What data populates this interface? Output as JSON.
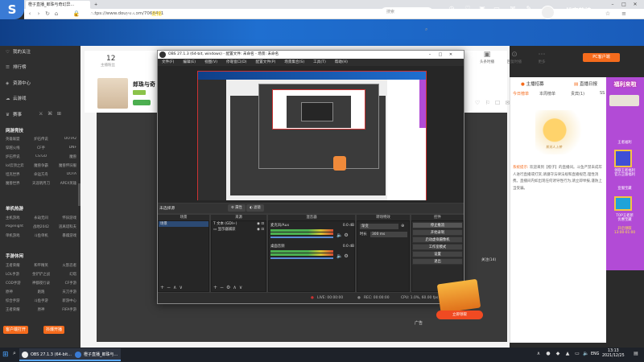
{
  "browser": {
    "tabs": [
      {
        "label": "橙子直播_郎珠与奇幻异..."
      },
      {
        "label": "+"
      }
    ],
    "url": "https://www.douyu.com/7068491"
  },
  "site": {
    "logo": "斗鱼",
    "nav": [
      "首页",
      "直播",
      "分类▾",
      "视频▾",
      "游戏▾",
      "鱼吧",
      "KPL秋决"
    ],
    "active_nav": "直播",
    "search_placeholder": "搜索",
    "right_icons": [
      {
        "label": "历史",
        "icon": "history-icon"
      },
      {
        "label": "关注",
        "icon": "follow-icon"
      },
      {
        "label": "开播",
        "icon": "broadcast-icon"
      },
      {
        "label": "客户端",
        "icon": "client-icon"
      },
      {
        "label": "消息",
        "icon": "message-icon"
      },
      {
        "label": "创作中心",
        "icon": "creator-icon"
      }
    ],
    "banner_text": "一战定乾坤"
  },
  "sidebar": {
    "items": [
      {
        "icon": "heart-icon",
        "label": "我的关注"
      },
      {
        "icon": "list-icon",
        "label": "排行榜"
      },
      {
        "icon": "resource-icon",
        "label": "资源中心"
      },
      {
        "icon": "cloud-icon",
        "label": "云游戏"
      },
      {
        "icon": "trophy-icon",
        "label": "赛事"
      }
    ],
    "sections": [
      {
        "title": "网游竞技",
        "items": [
          "英雄联盟",
          "炉石传说",
          "DOTA2",
          "穿越火线",
          "CF手",
          "DNF",
          "炉石传说",
          "CS:GO",
          "魔兽",
          "lol云顶之弈",
          "魔兽争霸",
          "魔兽怀旧服",
          "坦克世界",
          "命运方舟",
          "DOTA",
          "魔兽世界",
          "天涯明月刀",
          "APEX英雄"
        ]
      },
      {
        "title": "单机热游",
        "items": [
          "主机游戏",
          "永劫无间",
          "怀旧游戏",
          "Pogenight",
          "战地2042",
          "逃离塔科夫",
          "单机游戏",
          "斗鱼单机",
          "暴躁游戏"
        ]
      },
      {
        "title": "手游休闲",
        "items": [
          "王者荣耀",
          "和平精英",
          "火影忍者",
          "LOL手游",
          "金铲铲之战",
          "幻塔",
          "COD手游",
          "神都夜行录",
          "CF手游",
          "原神",
          "跑跑",
          "天刀手游",
          "综合手游",
          "斗鱼手游",
          "新游中心",
          "王者荣耀",
          "原神",
          "FIFA手游"
        ]
      }
    ],
    "buttons": [
      "客户端打开",
      "抖爆开播"
    ]
  },
  "room": {
    "stat_num": "12",
    "stat_label": "主播粉丝",
    "title": "郎珠与奇",
    "tools": [
      {
        "label": "头条时播",
        "icon": "camera-icon"
      },
      {
        "label": "回复时播",
        "icon": "reply-icon"
      },
      {
        "label": "更多",
        "icon": "more-icon"
      }
    ],
    "pc_client": "PC客户端",
    "time_badge": "关注(14)",
    "ad_label": "广告",
    "promo_btn": "立即领取"
  },
  "chat": {
    "top_left": "主播招募",
    "top_right": "直播日报",
    "tabs": [
      "今日榜单",
      "本周榜单",
      "贵宾(1)",
      "SS"
    ],
    "illus_text": "暂无人上榜",
    "system_msg_label": "系统提示:",
    "system_msg": "欢迎来到【橙子】的直播间。斗鱼严禁未成年人进行直播或打赏,请遵守法律法规和直播规范,理性消费。直播间内如出现任何诱导性行为,请立即举报,谨防上当受骗。"
  },
  "ads": {
    "top": "福利来啦",
    "items": [
      "王者福利",
      "领取王者福利\n官方正版福利",
      "亚服宝藏",
      "TOP王者新\n优惠宝藏",
      "开启领取\n13:00-01:00"
    ]
  },
  "obs": {
    "title": "OBS 27.1.3 (64-bit, windows) - 配置文件: 未命名 - 场景: 未命名",
    "menu": [
      "文件(F)",
      "编辑(E)",
      "视图(V)",
      "停靠窗口(D)",
      "配置文件(P)",
      "场景集合(S)",
      "工具(T)",
      "帮助(H)"
    ],
    "scene_label": "未选择源",
    "scene_props": "属性",
    "scene_filters": "滤镜",
    "docks": {
      "scenes": {
        "header": "场景",
        "items": [
          "场景"
        ]
      },
      "sources": {
        "header": "来源",
        "items": [
          "文本 (GDI+)",
          "显示器捕获"
        ]
      },
      "mixer": {
        "header": "混音器",
        "channels": [
          {
            "name": "麦克风/Aux",
            "db": "0.0 dB"
          },
          {
            "name": "桌面音频",
            "db": "0.0 dB"
          }
        ]
      },
      "transitions": {
        "header": "转场特效",
        "type": "渐变",
        "duration_label": "时长",
        "duration": "300 ms"
      },
      "controls": {
        "header": "控件",
        "buttons": [
          "停止推流",
          "开始录制",
          "启动虚拟摄像机",
          "工作室模式",
          "设置",
          "退出"
        ]
      }
    },
    "status": {
      "live_label": "LIVE:",
      "live_time": "00:00:00",
      "rec_label": "REC:",
      "rec_time": "00:00:00",
      "cpu": "CPU: 1.0%, 60.00 fps"
    }
  },
  "taskbar": {
    "items": [
      {
        "label": "OBS 27.1.3 (64-bit..."
      },
      {
        "label": "橙子直播_郎珠与..."
      }
    ],
    "lang": "ENG",
    "time": "13:13",
    "date": "2021/12/25"
  }
}
